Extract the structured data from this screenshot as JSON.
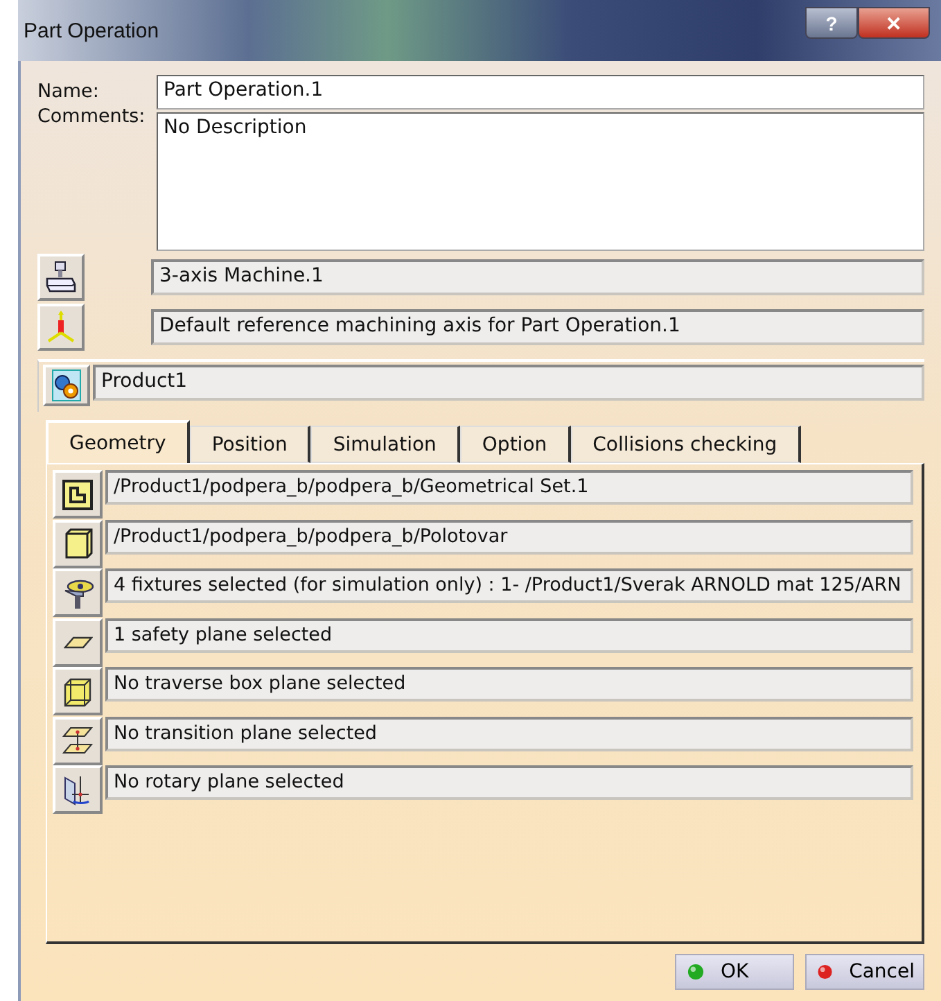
{
  "window": {
    "title": "Part Operation",
    "controls": [
      {
        "kind": "help",
        "label": "?"
      },
      {
        "kind": "close",
        "label": "✕"
      }
    ]
  },
  "name": {
    "label": "Name:",
    "value": "Part Operation.1"
  },
  "comments": {
    "label": "Comments:",
    "value": "No Description"
  },
  "machine": {
    "value": "3-axis Machine.1"
  },
  "axis": {
    "value": "Default reference machining axis for Part Operation.1"
  },
  "product": {
    "value": "Product1"
  },
  "tabs": [
    {
      "label": "Geometry",
      "selected": true
    },
    {
      "label": "Position",
      "selected": false
    },
    {
      "label": "Simulation",
      "selected": false
    },
    {
      "label": "Option",
      "selected": false
    },
    {
      "label": "Collisions checking",
      "selected": false
    }
  ],
  "geometry_rows": [
    {
      "kind": "geometrical-set",
      "text": "/Product1/podpera_b/podpera_b/Geometrical Set.1"
    },
    {
      "kind": "stock",
      "text": "/Product1/podpera_b/podpera_b/Polotovar"
    },
    {
      "kind": "fixture",
      "text": "4 fixtures selected (for simulation only) : 1- /Product1/Sverak ARNOLD mat 125/ARN"
    },
    {
      "kind": "safety-plane",
      "text": "1 safety plane selected"
    },
    {
      "kind": "traverse-box",
      "text": "No traverse box plane selected"
    },
    {
      "kind": "transition-plane",
      "text": "No transition plane selected"
    },
    {
      "kind": "rotary-plane",
      "text": "No rotary plane selected"
    }
  ],
  "buttons": [
    {
      "kind": "ok",
      "label": "OK"
    },
    {
      "kind": "cancel",
      "label": "Cancel"
    }
  ]
}
